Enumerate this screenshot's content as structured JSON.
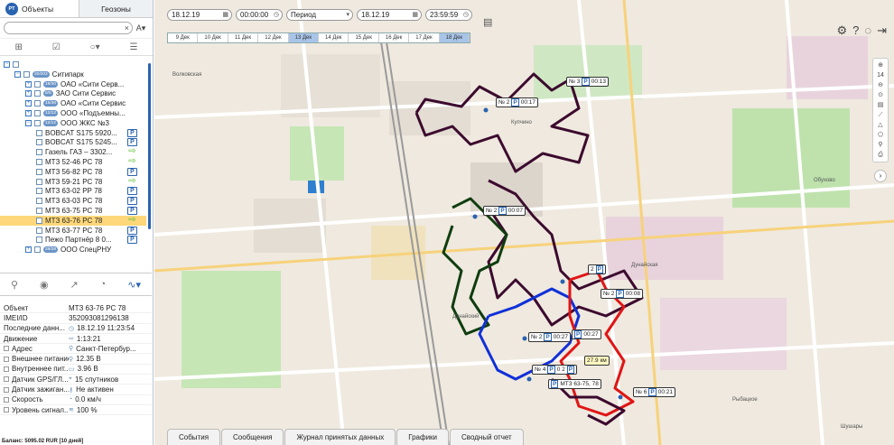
{
  "tabs": {
    "objects": "Объекты",
    "geozones": "Геозоны",
    "logo": "РТ"
  },
  "search": {
    "placeholder": "",
    "clear": "×",
    "sort": "A"
  },
  "tree": [
    {
      "indent": 0,
      "kind": "minus",
      "badge": "",
      "label": "",
      "icon": "",
      "clipped": true
    },
    {
      "indent": 1,
      "kind": "minus",
      "badge": "20/203",
      "label": "Ситипарк",
      "icon": ""
    },
    {
      "indent": 2,
      "kind": "plus",
      "badge": "19/30",
      "label": "ОАО «Сити Серв...",
      "icon": ""
    },
    {
      "indent": 2,
      "kind": "plus",
      "badge": "9/9",
      "label": "ЗАО Сити Сервис",
      "icon": ""
    },
    {
      "indent": 2,
      "kind": "plus",
      "badge": "15/36",
      "label": "ОАО «Сити Сервис",
      "icon": ""
    },
    {
      "indent": 2,
      "kind": "plus",
      "badge": "12/12",
      "label": "ООО «Подъемны...",
      "icon": ""
    },
    {
      "indent": 2,
      "kind": "minus",
      "badge": "12/12",
      "label": "ООО ЖКС №3",
      "icon": ""
    },
    {
      "indent": 3,
      "kind": "cb",
      "badge": "",
      "label": "BOBCAT S175 5920...",
      "icon": "P"
    },
    {
      "indent": 3,
      "kind": "cb",
      "badge": "",
      "label": "BOBCAT S175 5245...",
      "icon": "P"
    },
    {
      "indent": 3,
      "kind": "cb",
      "badge": "",
      "label": "Газель ГАЗ – 3302...",
      "icon": "arrow"
    },
    {
      "indent": 3,
      "kind": "cb",
      "badge": "",
      "label": "МТЗ 52-46 РС 78",
      "icon": "arrow"
    },
    {
      "indent": 3,
      "kind": "cb",
      "badge": "",
      "label": "МТЗ 56-82 РС 78",
      "icon": "P"
    },
    {
      "indent": 3,
      "kind": "cb",
      "badge": "",
      "label": "МТЗ 59-21 РС 78",
      "icon": "arrow"
    },
    {
      "indent": 3,
      "kind": "cb",
      "badge": "",
      "label": "МТЗ 63-02 РР 78",
      "icon": "P"
    },
    {
      "indent": 3,
      "kind": "cb",
      "badge": "",
      "label": "МТЗ 63-03 РС 78",
      "icon": "P"
    },
    {
      "indent": 3,
      "kind": "cb",
      "badge": "",
      "label": "МТЗ 63-75 РС 78",
      "icon": "P"
    },
    {
      "indent": 3,
      "kind": "cb",
      "badge": "",
      "label": "МТЗ 63-76 РС 78",
      "icon": "arrow",
      "selected": true
    },
    {
      "indent": 3,
      "kind": "cb",
      "badge": "",
      "label": "МТЗ 63-77 РС 78",
      "icon": "P"
    },
    {
      "indent": 3,
      "kind": "cb",
      "badge": "",
      "label": "Пежо Партнёр 8 0...",
      "icon": "P"
    },
    {
      "indent": 2,
      "kind": "plus",
      "badge": "28/28",
      "label": "ООО СпецРНУ",
      "icon": ""
    }
  ],
  "details": [
    {
      "label": "Объект",
      "value": "МТЗ 63-76 РС 78",
      "cb": false,
      "icon": ""
    },
    {
      "label": "IMEI/ID",
      "value": "352093081296138",
      "cb": false,
      "icon": ""
    },
    {
      "label": "Последние данн...",
      "value": "18.12.19 11:23:54",
      "cb": false,
      "icon": "◷"
    },
    {
      "label": "Движение",
      "value": "1:13:21",
      "cb": false,
      "icon": "⇨"
    },
    {
      "label": "Адрес",
      "value": "Санкт-Петербур...",
      "cb": true,
      "icon": "⚲"
    },
    {
      "label": "Внешнее питание",
      "value": "12.35 В",
      "cb": true,
      "icon": "⚲"
    },
    {
      "label": "Внутреннее пит...",
      "value": "3.96 В",
      "cb": true,
      "icon": "▭"
    },
    {
      "label": "Датчик GPS/ГЛ...",
      "value": "15 спутников",
      "cb": true,
      "icon": "⌖"
    },
    {
      "label": "Датчик зажиган...",
      "value": "Не активен",
      "cb": true,
      "icon": "⚷"
    },
    {
      "label": "Скорость",
      "value": "0.0 км/ч",
      "cb": true,
      "icon": "◔"
    },
    {
      "label": "Уровень сигнал...",
      "value": "100 %",
      "cb": true,
      "icon": "≋"
    }
  ],
  "balance": "Баланс: 5095.02 RUR [10 дней]",
  "datebar": {
    "date_from": "18.12.19",
    "time_from": "00:00:00",
    "period": "Период",
    "date_to": "18.12.19",
    "time_to": "23:59:59"
  },
  "timeline": [
    "9 Дек",
    "10 Дек",
    "11 Дек",
    "12 Дек",
    "13 Дек",
    "14 Дек",
    "15 Дек",
    "16 Дек",
    "17 Дек",
    "18 Дек"
  ],
  "zoom": {
    "level": "14"
  },
  "markers": [
    {
      "text": "№ 2",
      "time": "00:17"
    },
    {
      "text": "№ 3",
      "time": "00:13"
    },
    {
      "text": "№ 2",
      "time": "00:07"
    },
    {
      "text": "2",
      "time": ""
    },
    {
      "text": "№ 2",
      "time": "00:08"
    },
    {
      "text": "№ 2",
      "time": "00:27"
    },
    {
      "text": "",
      "time": "00:27"
    },
    {
      "text": "№ 4",
      "time": ""
    },
    {
      "text": "0 2",
      "time": ""
    },
    {
      "text": "27.9 км",
      "time": ""
    },
    {
      "text": "МТЗ 63-75, 78",
      "time": ""
    },
    {
      "text": "№ 6",
      "time": "00:21"
    }
  ],
  "map_labels": [
    "Купчино",
    "Обухово",
    "Дунайская",
    "Волковская",
    "Шушары",
    "Дунайский",
    "Рыбацкое"
  ],
  "bottom_tabs": [
    "События",
    "Сообщения",
    "Журнал принятых данных",
    "Графики",
    "Сводный отчет"
  ],
  "colors": {
    "track_purple": "#3c0a2e",
    "track_green": "#0f3d0f",
    "track_blue": "#1030d8",
    "track_red": "#e01515",
    "accent": "#2a63b0"
  }
}
